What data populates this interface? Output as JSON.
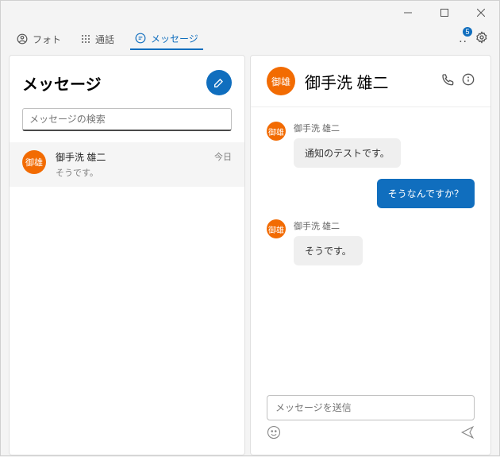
{
  "topbar": {
    "tabs": [
      {
        "label": "フォト"
      },
      {
        "label": "通話"
      },
      {
        "label": "メッセージ"
      }
    ],
    "badge": "5"
  },
  "leftPanel": {
    "title": "メッセージ",
    "searchPlaceholder": "メッセージの検索",
    "conversations": [
      {
        "avatar": "御雄",
        "name": "御手洗 雄二",
        "snippet": "そうです。",
        "time": "今日"
      }
    ]
  },
  "chat": {
    "headerAvatar": "御雄",
    "headerName": "御手洗 雄二",
    "messages": [
      {
        "dir": "in",
        "avatar": "御雄",
        "sender": "御手洗 雄二",
        "text": "通知のテストです。"
      },
      {
        "dir": "out",
        "text": "そうなんですか？"
      },
      {
        "dir": "in",
        "avatar": "御雄",
        "sender": "御手洗 雄二",
        "text": "そうです。"
      }
    ],
    "inputPlaceholder": "メッセージを送信"
  }
}
